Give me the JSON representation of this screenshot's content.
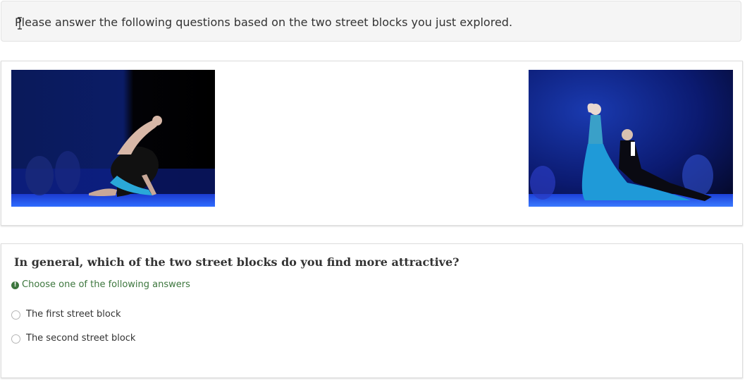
{
  "intro": {
    "text": "Please answer the following questions based on the two street blocks you just explored."
  },
  "images": {
    "left": {
      "icon": "dance-photo-left"
    },
    "right": {
      "icon": "dance-photo-right"
    }
  },
  "question": {
    "title": "In general, which of the two street blocks do you find more attractive?",
    "hint": "Choose one of the following answers",
    "hint_icon_glyph": "!",
    "options": [
      {
        "label": "The first street block",
        "selected": false
      },
      {
        "label": "The second street block",
        "selected": false
      }
    ]
  },
  "colors": {
    "hint_green": "#3c763d",
    "intro_bg": "#f5f5f5"
  }
}
